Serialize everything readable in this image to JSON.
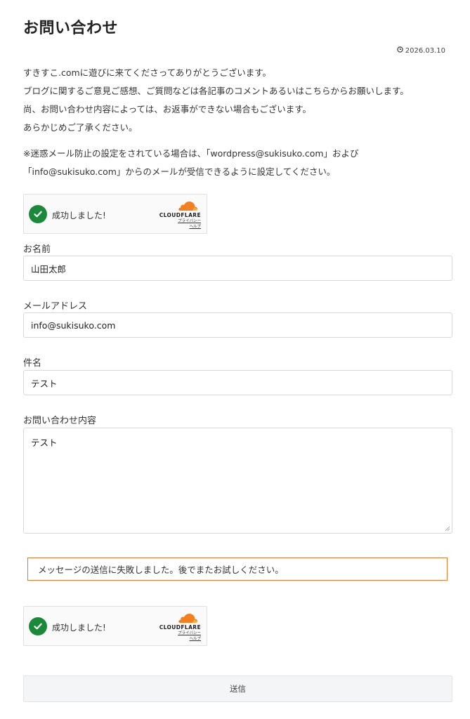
{
  "page": {
    "title": "お問い合わせ",
    "date": "2026.03.10"
  },
  "intro": [
    "すきすこ.comに遊びに来てくださってありがとうございます。",
    "ブログに関するご意見ご感想、ご質問などは各記事のコメントあるいはこちらからお願いします。",
    "尚、お問い合わせ内容によっては、お返事ができない場合もございます。",
    "あらかじめご了承ください。"
  ],
  "notice": [
    "※迷惑メール防止の設定をされている場合は、「wordpress@sukisuko.com」および",
    "「info@sukisuko.com」からのメールが受信できるように設定してください。"
  ],
  "turnstile": {
    "status": "成功しました!",
    "brand": "CLOUDFLARE",
    "privacy_link": "プライバシー",
    "help_link": "ヘルプ",
    "brand_color": "#f38020"
  },
  "form": {
    "name_label": "お名前",
    "name_value": "山田太郎",
    "email_label": "メールアドレス",
    "email_value": "info@sukisuko.com",
    "subject_label": "件名",
    "subject_value": "テスト",
    "message_label": "お問い合わせ内容",
    "message_value": "テスト",
    "error_message": "メッセージの送信に失敗しました。後でまたお試しください。",
    "submit_label": "送信"
  },
  "colors": {
    "success_green": "#1a8a3a",
    "error_border": "#e07a2f"
  }
}
